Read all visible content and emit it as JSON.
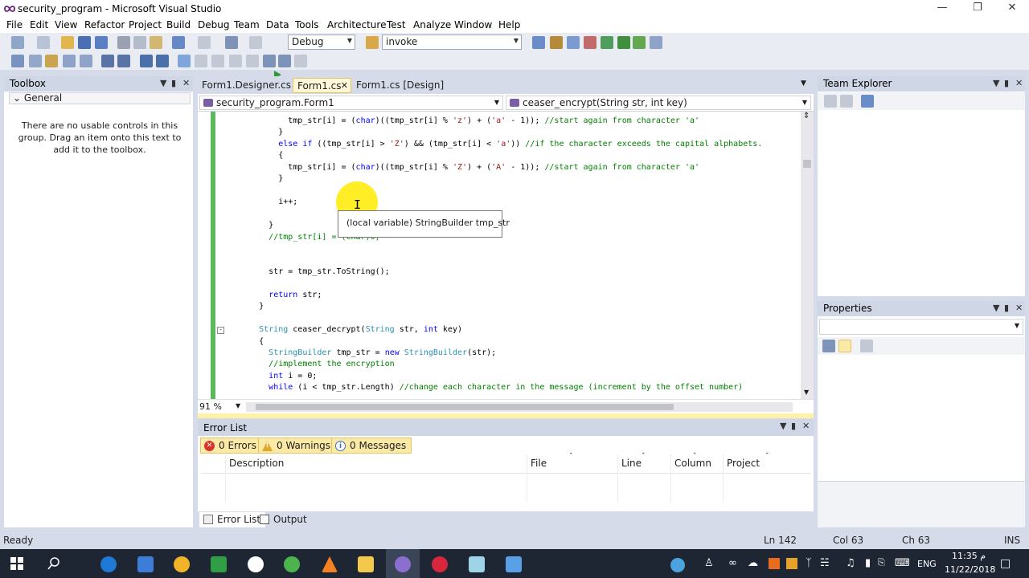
{
  "window": {
    "title": "security_program - Microsoft Visual Studio"
  },
  "menu": [
    "File",
    "Edit",
    "View",
    "Refactor",
    "Project",
    "Build",
    "Debug",
    "Team",
    "Data",
    "Tools",
    "Architecture",
    "Test",
    "Analyze",
    "Window",
    "Help"
  ],
  "toolbar": {
    "config": "Debug",
    "find": "invoke"
  },
  "toolbox": {
    "title": "Toolbox",
    "group": "General",
    "empty_message": "There are no usable controls in this group. Drag an item onto this text to add it to the toolbox."
  },
  "editor": {
    "tabs": [
      "Form1.Designer.cs",
      "Form1.cs",
      "Form1.cs [Design]"
    ],
    "class_nav": "security_program.Form1",
    "member_nav": "ceaser_encrypt(String str, int key)",
    "zoom": "91 %",
    "tooltip": "(local variable) StringBuilder tmp_str"
  },
  "code": [
    "            tmp_str[i] = (char)((tmp_str[i] % 'z') + ('a' - 1)); //start again from character 'a'",
    "          }",
    "          else if ((tmp_str[i] > 'Z') && (tmp_str[i] < 'a')) //if the character exceeds the capital alphabets.",
    "          {",
    "            tmp_str[i] = (char)((tmp_str[i] % 'Z') + ('A' - 1)); //start again from character 'a'",
    "          }",
    "",
    "          i++;",
    "",
    "        }",
    "        //tmp_str[i] = (char)0;",
    "",
    "",
    "        str = tmp_str.ToString();",
    "",
    "        return str;",
    "      }",
    "",
    "      String ceaser_decrypt(String str, int key)",
    "      {",
    "        StringBuilder tmp_str = new StringBuilder(str);",
    "        //implement the encryption",
    "        int i = 0;",
    "        while (i < tmp_str.Length) //change each character in the message (increment by the offset number)"
  ],
  "error_list": {
    "title": "Error List",
    "errors": "0 Errors",
    "warnings": "0 Warnings",
    "messages": "0 Messages",
    "columns": [
      "Description",
      "File",
      "Line",
      "Column",
      "Project"
    ],
    "tabs": [
      "Error List",
      "Output"
    ]
  },
  "team_explorer": {
    "title": "Team Explorer"
  },
  "properties": {
    "title": "Properties"
  },
  "status": {
    "ready": "Ready",
    "ln": "Ln 142",
    "col": "Col 63",
    "ch": "Ch 63",
    "ins": "INS"
  },
  "taskbar": {
    "time": "11:35 م",
    "date": "11/22/2018",
    "lang": "ENG"
  }
}
